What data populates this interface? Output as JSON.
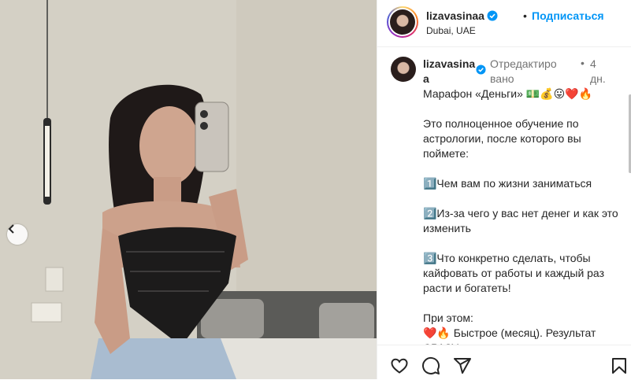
{
  "header": {
    "username": "lizavasinaa",
    "separator": "•",
    "follow_label": "Подписаться",
    "location": "Dubai, UAE"
  },
  "caption": {
    "username": "lizavasinaa",
    "edited_label": "Отредактировано",
    "separator": "•",
    "time": "4 дн.",
    "paragraphs": [
      "Марафон «Деньги» 💵💰😛❤️🔥",
      "Это полноценное обучение по астрологии, после которого вы поймете:",
      "1️⃣Чем вам по жизни заниматься",
      "2️⃣Из-за чего у вас нет денег и как это изменить",
      "3️⃣Что конкретно сделать, чтобы кайфовать от работы и каждый раз расти и богатеть!",
      "При этом:\n❤️🔥 Быстрое (месяц). Результат СРАЗУ."
    ]
  },
  "icons": {
    "verified": "verified-badge-icon",
    "like": "heart-icon",
    "comment": "comment-icon",
    "share": "send-icon",
    "save": "bookmark-icon",
    "prev": "chevron-left-icon"
  },
  "colors": {
    "accent": "#0095f6",
    "text": "#262626",
    "muted": "#737373"
  }
}
